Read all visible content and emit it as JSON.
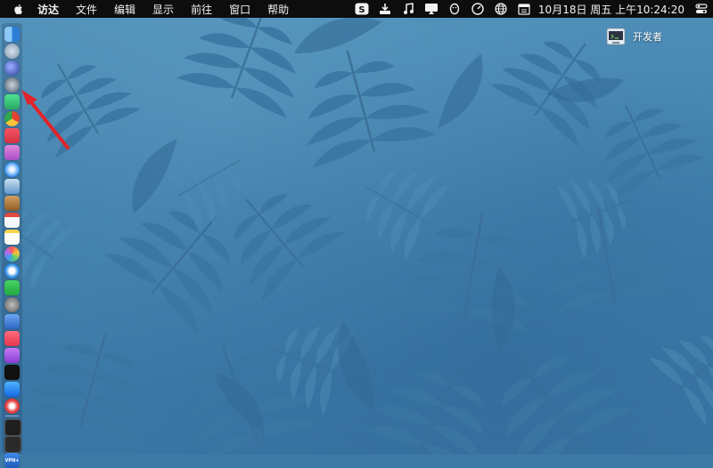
{
  "menubar": {
    "apple_icon": "apple-logo-icon",
    "items": [
      "访达",
      "文件",
      "编辑",
      "显示",
      "前往",
      "窗口",
      "帮助"
    ],
    "status_icons": [
      "sogou-input-icon",
      "download-icon",
      "music-note-icon",
      "screen-mirror-icon",
      "qq-penguin-icon",
      "clock-gauge-icon",
      "globe-icon",
      "calendar-icon"
    ],
    "clock": "10月18日 周五 上午10:24:20",
    "control_icon": "control-center-icon"
  },
  "desktop": {
    "icons": [
      {
        "label": "开发者",
        "icon": "developer-folder-icon"
      }
    ]
  },
  "dock": {
    "items": [
      {
        "name": "finder",
        "color": "#3f8fe0"
      },
      {
        "name": "launchpad",
        "color": "#9fb6c9"
      },
      {
        "name": "safari-alt",
        "color": "#3c5fc0"
      },
      {
        "name": "rocket",
        "color": "#607080"
      },
      {
        "name": "android-studio",
        "color": "#3ddc84"
      },
      {
        "name": "chrome",
        "color": "#e34133"
      },
      {
        "name": "todo",
        "color": "#e8424f"
      },
      {
        "name": "app-purple",
        "color": "#b34fd0"
      },
      {
        "name": "safari",
        "color": "#2f8ff0"
      },
      {
        "name": "preview",
        "color": "#6aa6d8"
      },
      {
        "name": "books",
        "color": "#b07a3a"
      },
      {
        "name": "calendar",
        "color": "#f4f4f4"
      },
      {
        "name": "notes",
        "color": "#f7d54b"
      },
      {
        "name": "photos",
        "color": "#f1a33c"
      },
      {
        "name": "qq",
        "color": "#2d8de8"
      },
      {
        "name": "wechat",
        "color": "#2ac14a"
      },
      {
        "name": "system-prefs",
        "color": "#8a8a8a"
      },
      {
        "name": "keynote",
        "color": "#3f7ed6"
      },
      {
        "name": "music",
        "color": "#fa4d5f"
      },
      {
        "name": "podcasts",
        "color": "#a050e0"
      },
      {
        "name": "tv",
        "color": "#111111"
      },
      {
        "name": "app-store",
        "color": "#1c8df3"
      },
      {
        "name": "vivaldi",
        "color": "#e23c3c"
      },
      {
        "name": "terminal",
        "color": "#1e1e1e"
      },
      {
        "name": "activity-monitor",
        "color": "#2a2a2a"
      },
      {
        "name": "vpn",
        "color": "#2a6fcf"
      }
    ],
    "vpn_label": "VPN+"
  },
  "annotation": {
    "type": "arrow",
    "color": "#e0242a"
  }
}
